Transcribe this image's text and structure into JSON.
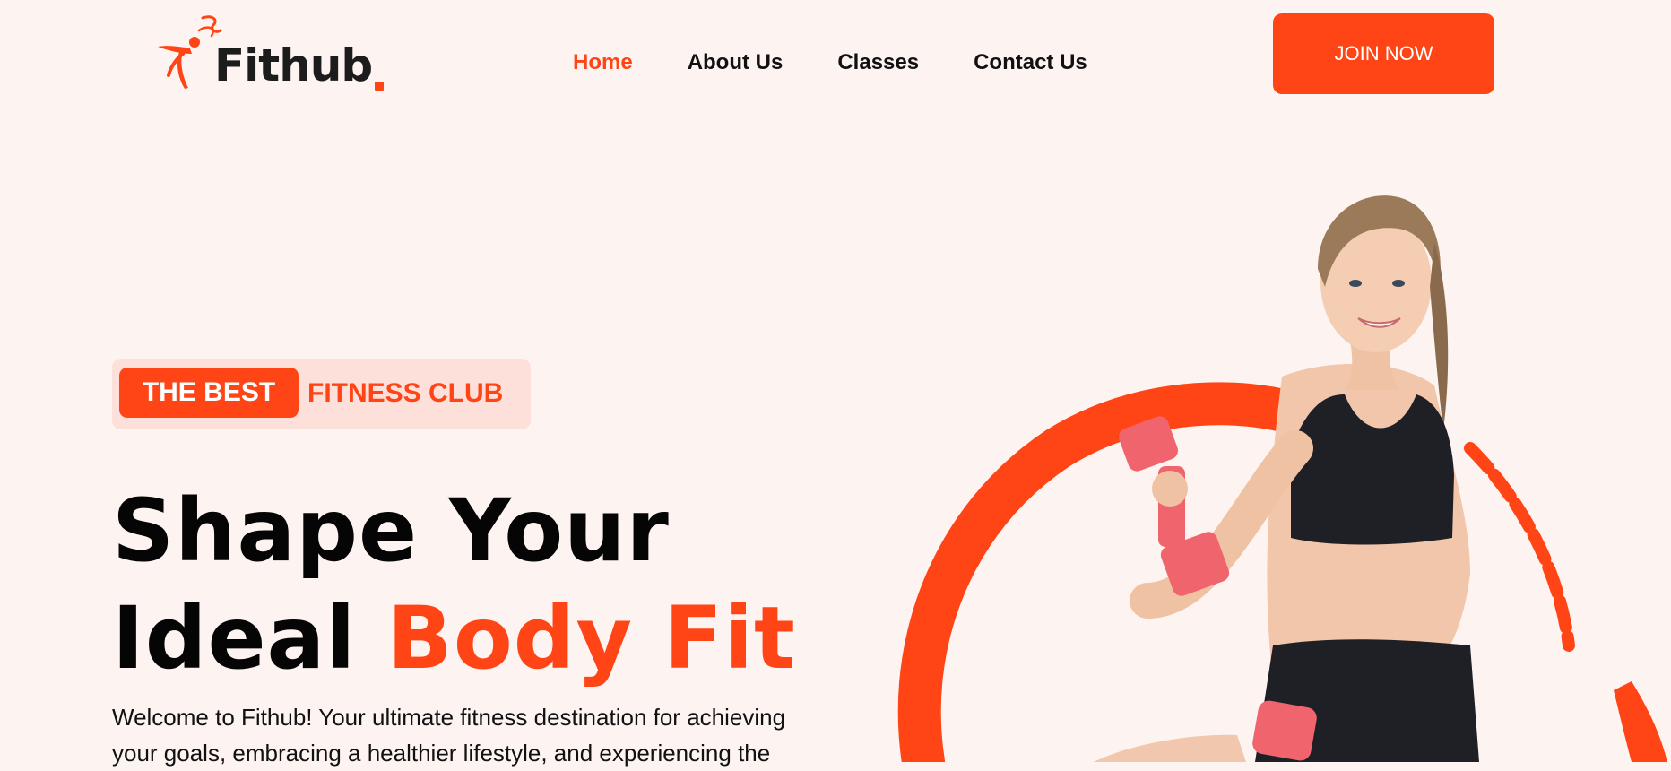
{
  "brand": {
    "name": "Fithub",
    "accent_color": "#ff4415",
    "logo_icon": "dancer-ribbon-icon"
  },
  "nav": {
    "items": [
      {
        "label": "Home",
        "active": true
      },
      {
        "label": "About Us",
        "active": false
      },
      {
        "label": "Classes",
        "active": false
      },
      {
        "label": "Contact Us",
        "active": false
      }
    ]
  },
  "header": {
    "join_label": "JOIN NOW"
  },
  "hero": {
    "tag_highlight": "THE BEST",
    "tag_rest": "FITNESS CLUB",
    "title_line1": "Shape Your",
    "title_line2_plain": "Ideal",
    "title_line2_accent": "Body Fit",
    "description": "Welcome to Fithub! Your ultimate fitness destination for achieving your goals, embracing a healthier lifestyle, and experiencing the",
    "image": "woman-holding-dumbbells-photo",
    "decoration": "orange-brush-circle"
  },
  "colors": {
    "background": "#fdf4f2",
    "accent": "#ff4415",
    "tag_background": "#fde0da",
    "text": "#0a0a0a"
  }
}
